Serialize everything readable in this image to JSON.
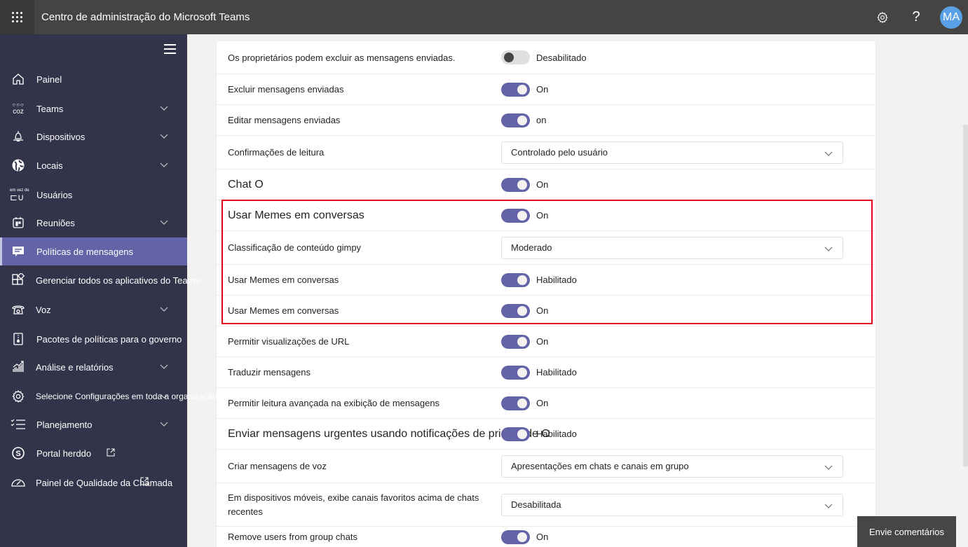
{
  "header": {
    "app_title": "Centro de administração do Microsoft Teams",
    "avatar_initials": "MA",
    "icons": [
      "waffle-icon",
      "gear-icon",
      "help-icon"
    ],
    "help_glyph": "?"
  },
  "sidebar": {
    "items": [
      {
        "label": "Painel",
        "icon": "home-icon",
        "chevron": false
      },
      {
        "label": "Teams",
        "icon": "teams-icon",
        "icon_text": "coz",
        "chevron": true
      },
      {
        "label": "Dispositivos",
        "icon": "device-icon",
        "chevron": true
      },
      {
        "label": "Locais",
        "icon": "globe-icon",
        "chevron": true
      },
      {
        "label": "Usuários",
        "icon": "users-icon",
        "icon_text": "em vez de",
        "chevron": false
      },
      {
        "label": "Reuniões",
        "icon": "calendar-icon",
        "chevron": true
      },
      {
        "label": "Políticas de mensagens",
        "icon": "message-icon",
        "chevron": false,
        "active": true
      },
      {
        "label": "Gerenciar todos os aplicativos do Teams",
        "icon": "apps-icon",
        "chevron": false
      },
      {
        "label": "Voz",
        "icon": "phone-icon",
        "chevron": true
      },
      {
        "label": "Pacotes de políticas para o governo",
        "icon": "policy-package-icon",
        "chevron": false
      },
      {
        "label": "Análise e relatórios",
        "icon": "analytics-icon",
        "chevron": true
      },
      {
        "label": "Selecione Configurações em toda a organização",
        "icon": "settings-icon",
        "chevron": true
      },
      {
        "label": "Planejamento",
        "icon": "checklist-icon",
        "chevron": true
      },
      {
        "label": "Portal herddo",
        "icon": "skype-icon",
        "chevron": false,
        "external": true
      },
      {
        "label": "Painel de Qualidade da Chamada",
        "icon": "gauge-icon",
        "chevron": false,
        "external": true
      }
    ]
  },
  "settings": {
    "rows": [
      {
        "label": "Os proprietários podem excluir as mensagens enviadas.",
        "type": "toggle",
        "on": false,
        "value": "Desabilitado"
      },
      {
        "label": "Excluir mensagens enviadas",
        "type": "toggle",
        "on": true,
        "value": "On"
      },
      {
        "label": "Editar mensagens enviadas",
        "type": "toggle",
        "on": true,
        "value": "on"
      },
      {
        "label": "Confirmações de leitura",
        "type": "dropdown",
        "value": "Controlado pelo usuário"
      },
      {
        "label": "Chat O",
        "type": "toggle",
        "on": true,
        "value": "On",
        "big": true
      },
      {
        "label": "Usar Memes em conversas",
        "type": "toggle",
        "on": true,
        "value": "On",
        "big": true
      },
      {
        "label": "Classificação de conteúdo gimpy",
        "type": "dropdown",
        "value": "Moderado"
      },
      {
        "label": "Usar Memes em conversas",
        "type": "toggle",
        "on": true,
        "value": "Habilitado"
      },
      {
        "label": "Usar Memes em conversas",
        "type": "toggle",
        "on": true,
        "value": "On"
      },
      {
        "label": "Permitir visualizações de URL",
        "type": "toggle",
        "on": true,
        "value": "On"
      },
      {
        "label": "Traduzir mensagens",
        "type": "toggle",
        "on": true,
        "value": "Habilitado"
      },
      {
        "label": "Permitir leitura avançada na exibição de mensagens",
        "type": "toggle",
        "on": true,
        "value": "On"
      },
      {
        "label": "Enviar mensagens urgentes usando notificações de prioridade O",
        "type": "toggle",
        "on": true,
        "value": "Habilitado",
        "big": true
      },
      {
        "label": "Criar mensagens de voz",
        "type": "dropdown",
        "value": "Apresentações em chats e canais em grupo"
      },
      {
        "label": "Em dispositivos móveis, exibe canais favoritos acima de chats recentes",
        "type": "dropdown",
        "value": "Desabilitada",
        "multi": true
      },
      {
        "label": "Remove users from group chats",
        "type": "toggle",
        "on": true,
        "value": "On"
      }
    ]
  },
  "feedback": {
    "label": "Envie comentários"
  },
  "colors": {
    "accent": "#6264a7",
    "highlight_border": "#e3001b",
    "topbar": "#464442",
    "sidebar": "#33344a"
  }
}
